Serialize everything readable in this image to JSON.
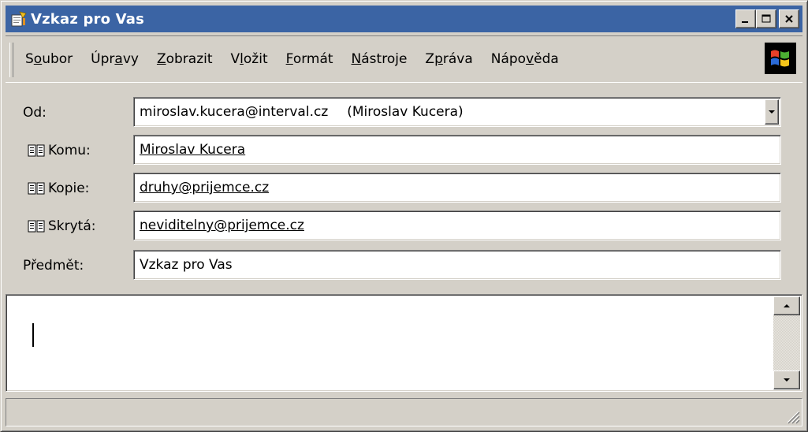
{
  "window": {
    "title": "Vzkaz pro Vas"
  },
  "title_buttons": {
    "minimize_glyph": "_",
    "maximize_glyph": "□",
    "close_glyph": "✕"
  },
  "menu": {
    "items": [
      {
        "before": "S",
        "accel": "o",
        "after": "ubor"
      },
      {
        "before": "Úpr",
        "accel": "a",
        "after": "vy"
      },
      {
        "before": "",
        "accel": "Z",
        "after": "obrazit"
      },
      {
        "before": "V",
        "accel": "l",
        "after": "ožit"
      },
      {
        "before": "",
        "accel": "F",
        "after": "ormát"
      },
      {
        "before": "",
        "accel": "N",
        "after": "ástroje"
      },
      {
        "before": "Z",
        "accel": "p",
        "after": "ráva"
      },
      {
        "before": "Nápo",
        "accel": "v",
        "after": "ěda"
      }
    ]
  },
  "fields": {
    "from": {
      "label": "Od:",
      "email": "miroslav.kucera@interval.cz",
      "name": "(Miroslav Kucera)"
    },
    "to": {
      "label": "Komu:",
      "value": "Miroslav Kucera"
    },
    "cc": {
      "label": "Kopie:",
      "value": "druhy@prijemce.cz"
    },
    "bcc": {
      "label": "Skrytá:",
      "value": "neviditelny@prijemce.cz"
    },
    "subject": {
      "label": "Předmět:",
      "value": "Vzkaz pro Vas"
    }
  },
  "body": {
    "text": ""
  },
  "status": {
    "text": ""
  },
  "colors": {
    "titlebar": "#3b64a4",
    "face": "#d4d0c8"
  }
}
